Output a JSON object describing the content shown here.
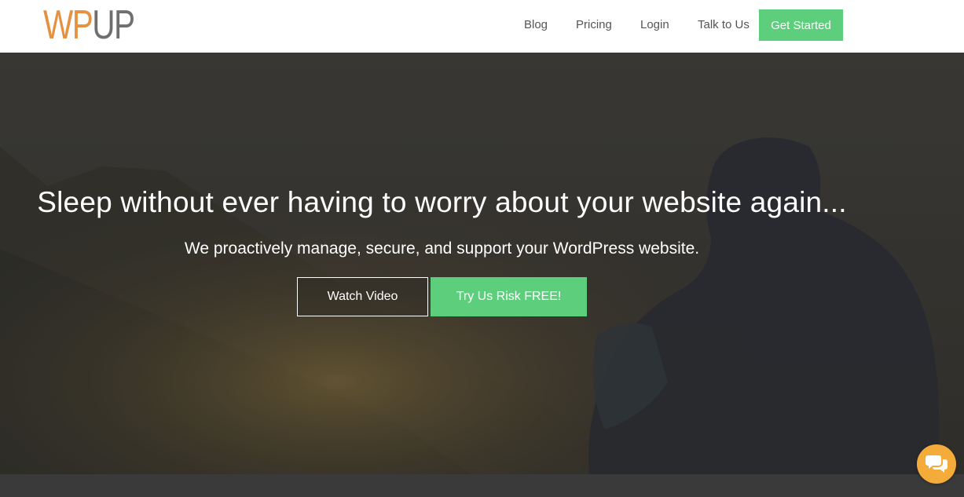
{
  "logo": {
    "part1": "WP",
    "part2": "UP"
  },
  "nav": {
    "links": [
      "Blog",
      "Pricing",
      "Login",
      "Talk to Us"
    ],
    "cta": "Get Started"
  },
  "hero": {
    "title": "Sleep without ever having to worry about your website again...",
    "subtitle": "We proactively manage, secure, and support your WordPress website.",
    "watch_video": "Watch Video",
    "try_free": "Try Us Risk FREE!"
  },
  "colors": {
    "accent_green": "#5dcf7c",
    "logo_orange": "#e5913f",
    "logo_gray": "#6f6f6f",
    "chat_orange": "#f3ab39"
  },
  "icons": {
    "chat": "chat-bubbles-icon"
  }
}
